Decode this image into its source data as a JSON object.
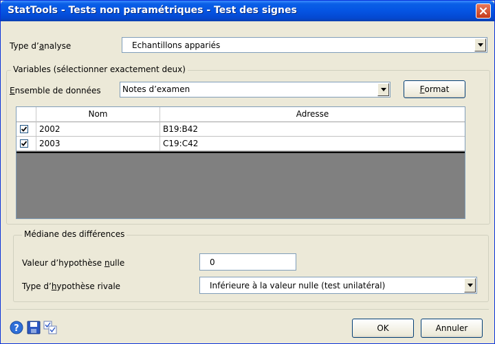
{
  "window": {
    "title": "StatTools - Tests non paramétriques - Test des signes"
  },
  "analysis": {
    "label_pre": "Type d’",
    "label_u": "a",
    "label_post": "nalyse",
    "value": "Echantillons appariés"
  },
  "variables": {
    "group_title": "Variables (sélectionner exactement deux)",
    "dataset_label_u": "E",
    "dataset_label_post": "nsemble de données",
    "dataset_value": "Notes d’examen",
    "format_u": "F",
    "format_post": "ormat",
    "columns": [
      "Nom",
      "Adresse"
    ],
    "rows": [
      {
        "checked": true,
        "name": "2002",
        "address": "B19:B42"
      },
      {
        "checked": true,
        "name": "2003",
        "address": "C19:C42"
      }
    ]
  },
  "median": {
    "group_title": "Médiane des différences",
    "null_label_pre": "Valeur d’hypothèse ",
    "null_label_u": "n",
    "null_label_post": "ulle",
    "null_value": "0",
    "alt_label_pre": "Type d’",
    "alt_label_u": "h",
    "alt_label_post": "ypothèse rivale",
    "alt_value": "Inférieure à la valeur nulle (test unilatéral)"
  },
  "footer": {
    "ok_label": "OK",
    "cancel_label": "Annuler",
    "icons": [
      "help-icon",
      "save-icon",
      "preferences-icon"
    ]
  },
  "colors": {
    "titlebar": "#0554e3",
    "close": "#c4391b",
    "window_bg": "#ece9d8",
    "grid_empty": "#808080"
  }
}
